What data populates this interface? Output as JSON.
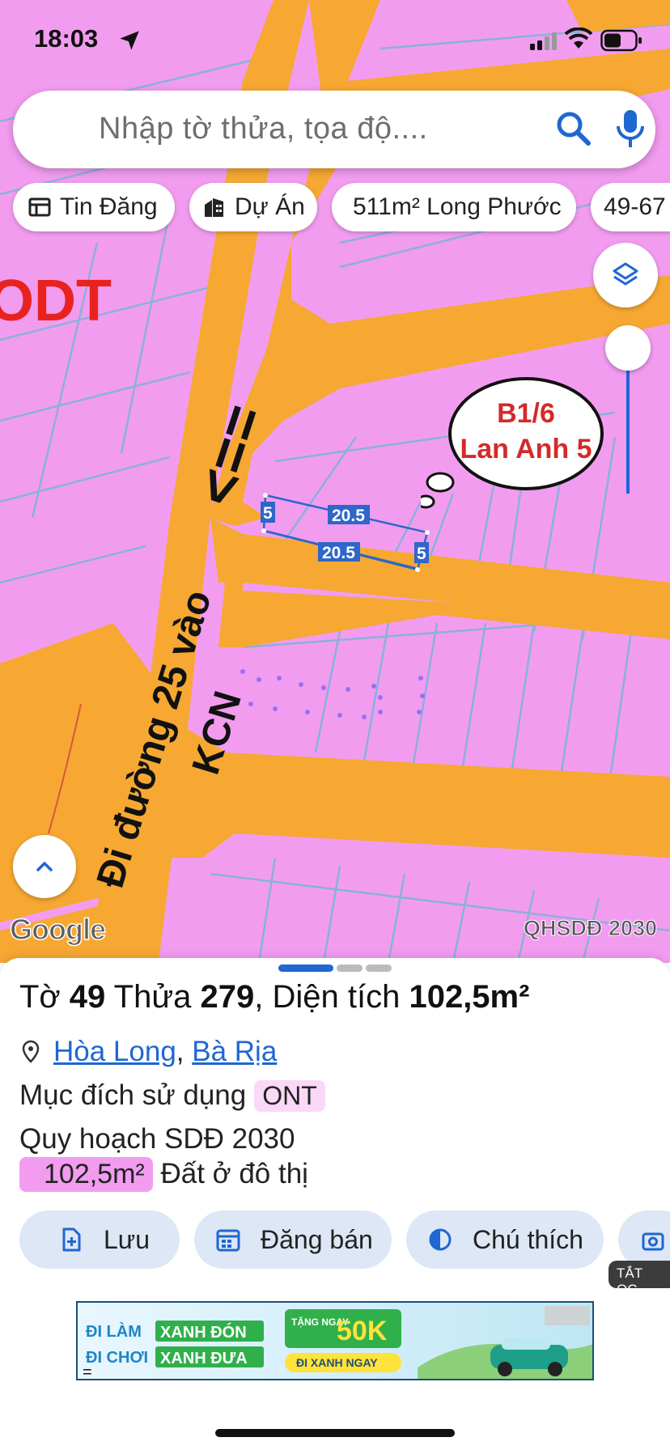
{
  "status_bar": {
    "time": "18:03"
  },
  "search": {
    "placeholder": "Nhập tờ thửa, tọa độ...."
  },
  "chips": [
    {
      "label": "Tin Đăng",
      "icon": "table-icon"
    },
    {
      "label": "Dự Án",
      "icon": "buildings-icon"
    },
    {
      "label": "511m² Long Phước"
    },
    {
      "label": "49-67"
    }
  ],
  "map": {
    "zone_label": "ODT",
    "bubble_line1": "B1/6",
    "bubble_line2": "Lan Anh 5",
    "road_arrow": "<==",
    "road_line1": "Đi đường 25 vào",
    "road_line2": "KCN",
    "dims": {
      "top_long": "20.5",
      "bottom_long": "20.5",
      "left_short": "5",
      "right_short": "5"
    },
    "google_label": "Google",
    "plan_label": "QHSDĐ 2030",
    "colors": {
      "land": "#f29cf0",
      "road": "#f6a832",
      "parcel_line": "#7fb4d6",
      "measure": "#2f66c9"
    }
  },
  "sheet": {
    "title_prefix": "Tờ ",
    "sheet_no": "49",
    "title_mid": " Thửa ",
    "parcel_no": "279",
    "title_area_prefix": ", Diện tích ",
    "area": "102,5m²",
    "location_ward": "Hòa Long",
    "location_sep": ", ",
    "location_city": "Bà Rịa",
    "usage_label": "Mục đích sử dụng",
    "usage_code": "ONT",
    "plan_line": "Quy hoạch SDĐ 2030",
    "plan_area": "102,5m²",
    "plan_desc": "Đất ở đô thị",
    "actions": [
      "Lưu",
      "Đăng bán",
      "Chú thích"
    ],
    "ad_tag": "TẮT QC",
    "ad": {
      "line1_a": "ĐI LÀM",
      "line1_b": "XANH ĐÓN",
      "line2_a": "ĐI CHƠI",
      "line2_b": "XANH ĐƯA",
      "promo_small": "TẶNG NGAY",
      "promo_big": "50K",
      "cta": "ĐI XANH NGAY"
    }
  }
}
